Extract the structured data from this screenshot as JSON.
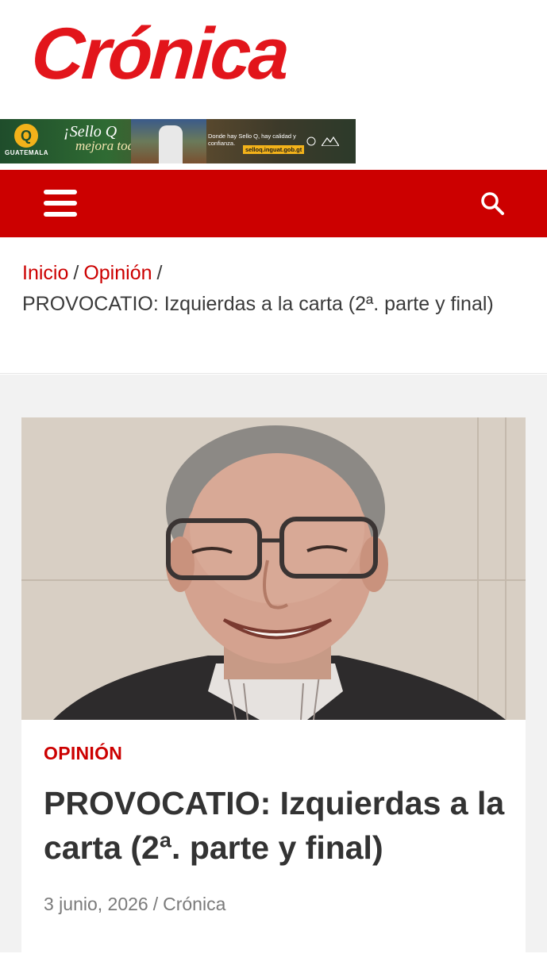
{
  "site": {
    "logo_text": "Crónica",
    "brand_color": "#e2151b"
  },
  "ad": {
    "brand": "GUATEMALA",
    "slogan_line1": "¡Sello Q",
    "slogan_line2": "mejora todo!",
    "tagline": "Donde hay Sello Q, hay calidad y confianza.",
    "url": "selloq.inguat.gob.gt"
  },
  "navbar": {
    "background": "#cc0000",
    "menu_icon": "hamburger-menu-icon",
    "search_icon": "search-icon"
  },
  "breadcrumb": {
    "items": [
      {
        "label": "Inicio"
      },
      {
        "label": "Opinión"
      }
    ],
    "separator": "/",
    "current": "PROVOCATIO: Izquierdas a la carta (2ª. parte y final)"
  },
  "article": {
    "category": "OPINIÓN",
    "title": "PROVOCATIO: Izquierdas a la carta (2ª. parte y final)",
    "date": "3 junio, 2026",
    "meta_separator": "/",
    "author": "Crónica"
  }
}
